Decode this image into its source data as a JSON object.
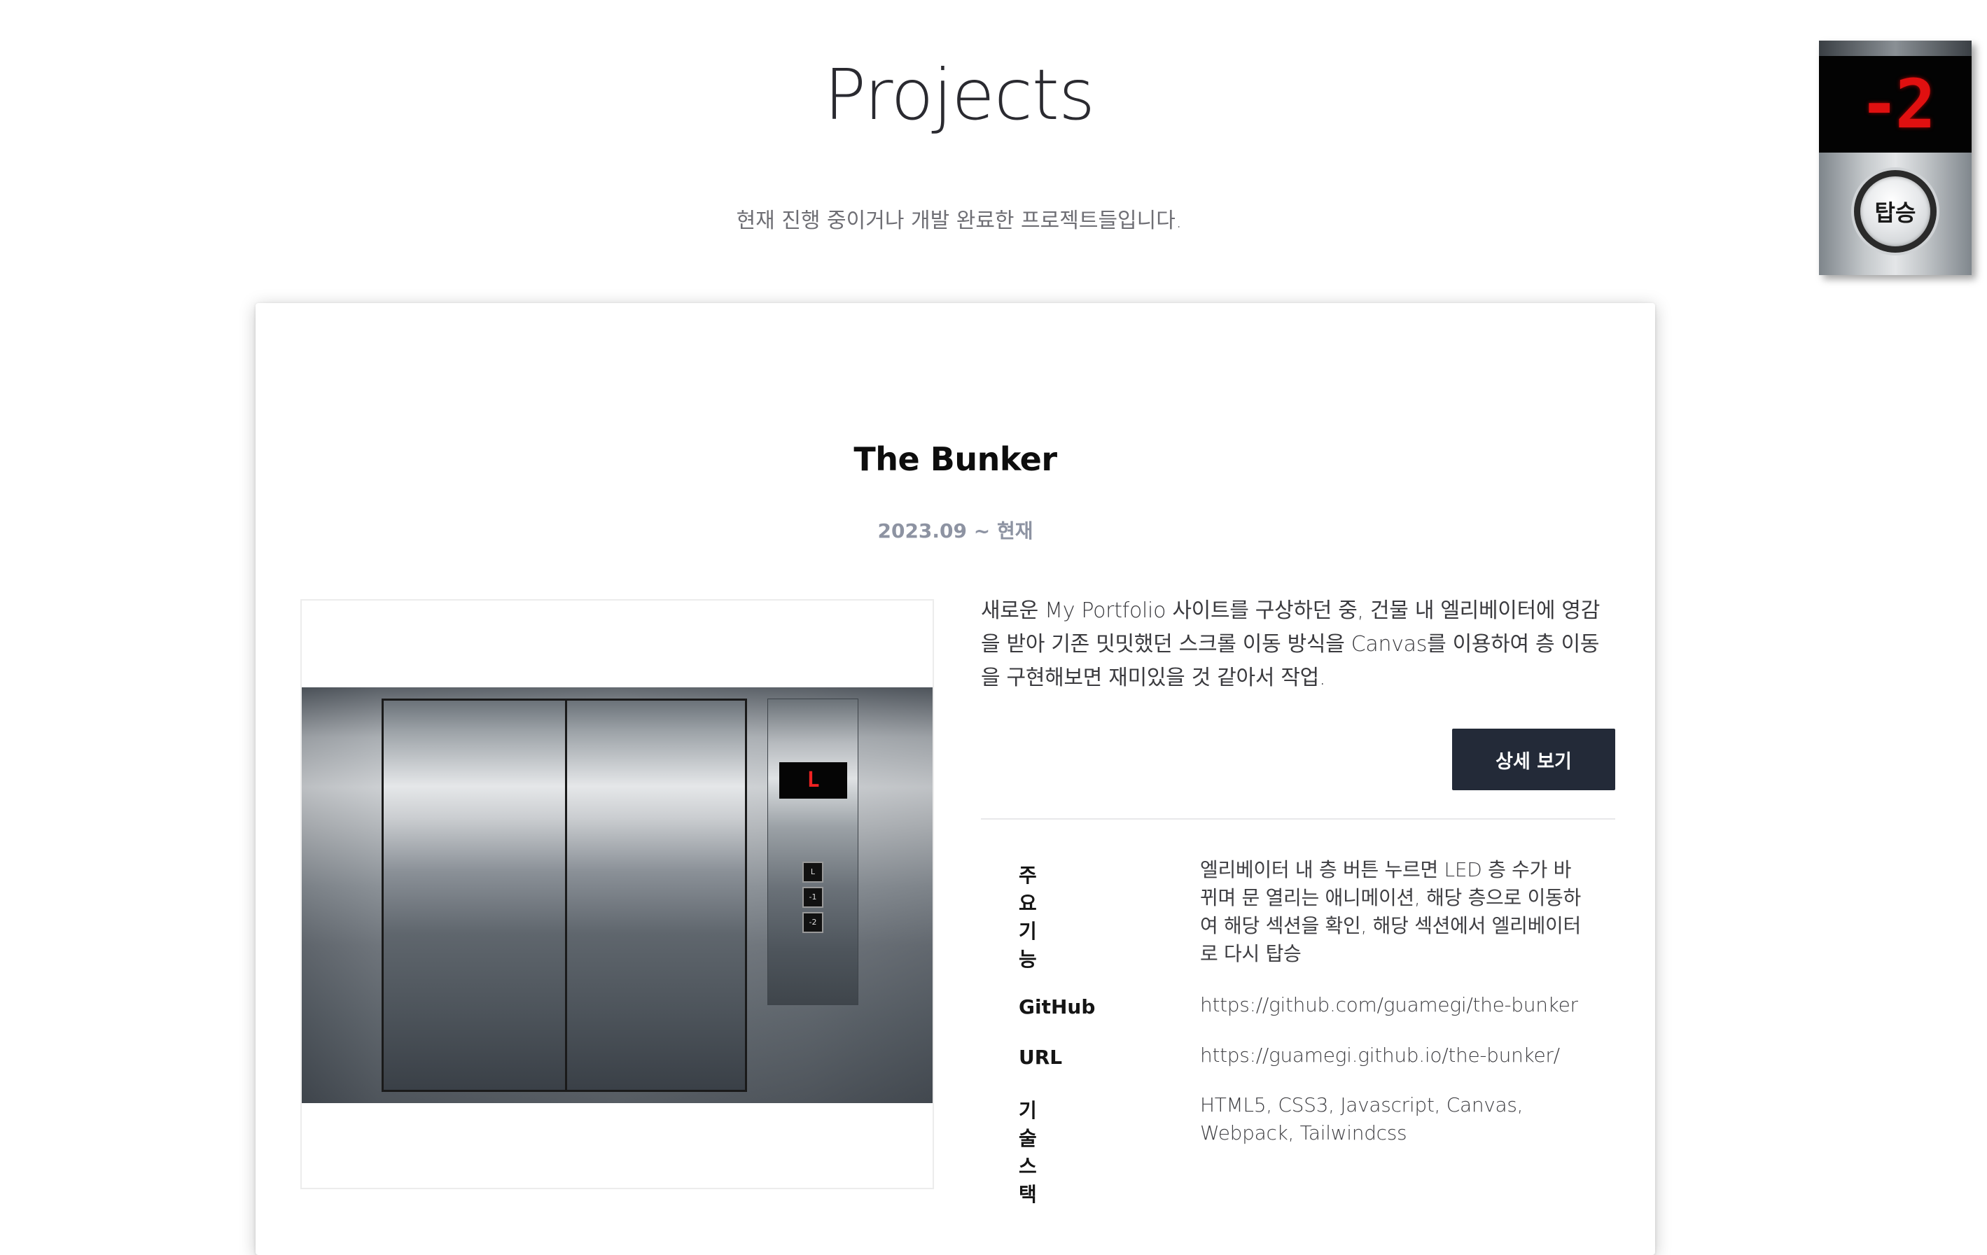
{
  "page": {
    "title": "Projects",
    "subtitle": "현재 진행 중이거나 개발 완료한 프로젝트들입니다."
  },
  "project": {
    "title": "The Bunker",
    "period": "2023.09 ~ 현재",
    "description": "새로운 My Portfolio 사이트를 구상하던 중, 건물 내 엘리베이터에 영감을 받아 기존 밋밋했던 스크롤 이동 방식을 Canvas를 이용하여 층 이동을 구현해보면 재미있을 것 같아서 작업.",
    "detail_button_label": "상세 보기",
    "thumbnail": {
      "floor_display": "L",
      "floor_buttons": [
        "L",
        "-1",
        "-2"
      ]
    },
    "info": {
      "features_label": "주요 기능",
      "features_value": "엘리베이터 내 층 버튼 누르면 LED 층 수가 바뀌며 문 열리는 애니메이션, 해당 층으로 이동하여 해당 섹션을 확인, 해당 섹션에서 엘리베이터로 다시 탑승",
      "github_label": "GitHub",
      "github_value": "https://github.com/guamegi/the-bunker",
      "url_label": "URL",
      "url_value": "https://guamegi.github.io/the-bunker/",
      "stack_label": "기술 스택",
      "stack_value": "HTML5, CSS3, Javascript, Canvas, Webpack, Tailwindcss"
    }
  },
  "elevator_widget": {
    "floor_display": "-2",
    "board_button_label": "탑승",
    "led_color": "#e01010"
  },
  "colors": {
    "button_bg": "#232a38",
    "date_text": "#8d93a2"
  }
}
